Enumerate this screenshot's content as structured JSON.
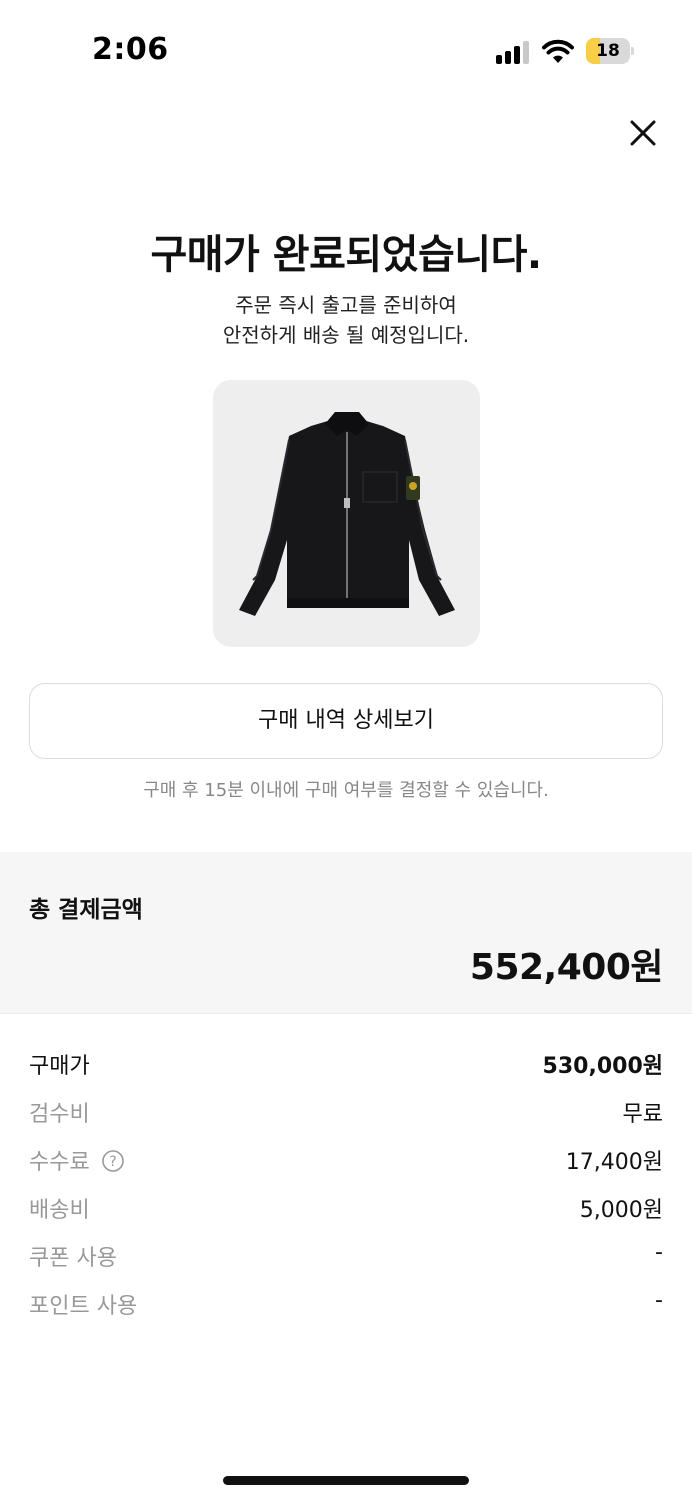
{
  "status_bar": {
    "time": "2:06",
    "battery_level": "18",
    "battery_fraction": 0.18,
    "battery_color": "#f7ce46"
  },
  "header": {
    "close_icon": "close-icon"
  },
  "confirmation": {
    "title": "구매가 완료되었습니다.",
    "subtitle_line1": "주문 즉시 출고를 준비하여",
    "subtitle_line2": "안전하게 배송 될 예정입니다."
  },
  "product": {
    "image_icon": "black-zip-jacket-image"
  },
  "actions": {
    "detail_label": "구매 내역 상세보기",
    "notice": "구매 후 15분 이내에 구매 여부를 결정할 수 있습니다."
  },
  "total": {
    "label": "총 결제금액",
    "value": "552,400원"
  },
  "breakdown": [
    {
      "label": "구매가",
      "value": "530,000원"
    },
    {
      "label": "검수비",
      "value": "무료"
    },
    {
      "label": "수수료",
      "value": "17,400원"
    },
    {
      "label": "배송비",
      "value": "5,000원"
    },
    {
      "label": "쿠폰 사용",
      "value": "-"
    },
    {
      "label": "포인트 사용",
      "value": "-"
    }
  ]
}
